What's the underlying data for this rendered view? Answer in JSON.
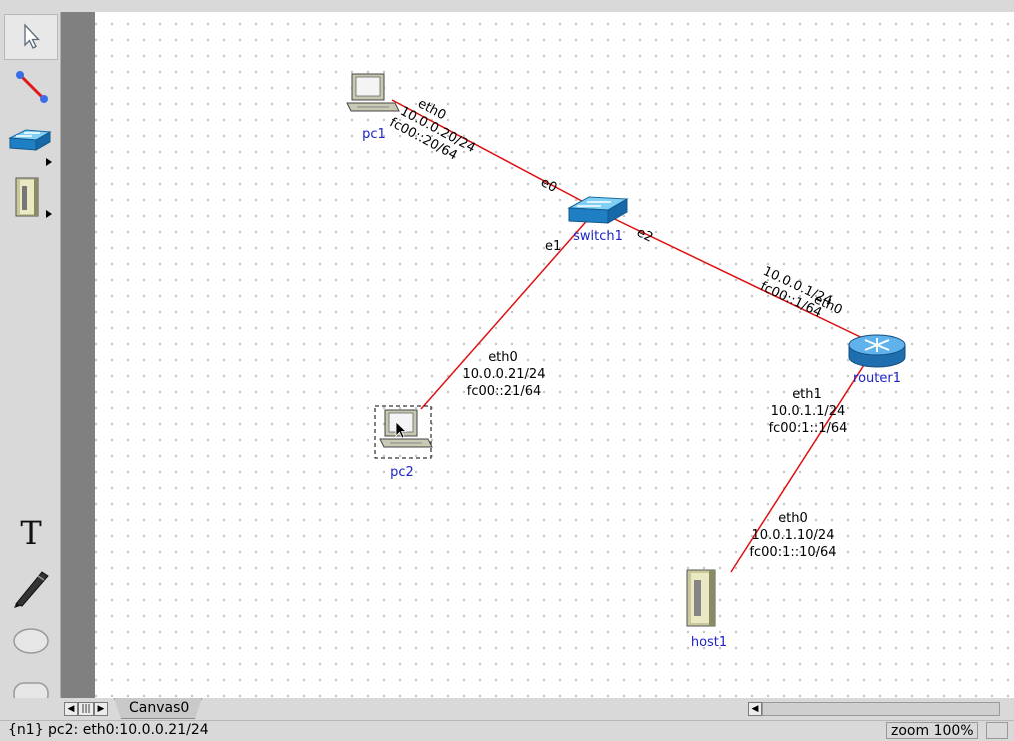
{
  "toolbar": {
    "tools": [
      {
        "name": "select-tool",
        "icon": "arrow-pointer-icon"
      },
      {
        "name": "link-tool",
        "icon": "link-line-icon"
      },
      {
        "name": "network-layer-tool",
        "icon": "switch-icon"
      },
      {
        "name": "link-layer-tool",
        "icon": "server-icon"
      },
      {
        "name": "text-tool",
        "icon": "text-T-icon"
      },
      {
        "name": "freehand-tool",
        "icon": "pen-icon"
      },
      {
        "name": "oval-tool",
        "icon": "oval-icon"
      },
      {
        "name": "rectangle-tool",
        "icon": "rounded-rect-icon"
      }
    ],
    "text_tool_glyph": "T"
  },
  "canvas": {
    "tab_label": "Canvas0",
    "nodes": {
      "pc1": {
        "label": "pc1"
      },
      "switch1": {
        "label": "switch1"
      },
      "router1": {
        "label": "router1"
      },
      "pc2": {
        "label": "pc2"
      },
      "host1": {
        "label": "host1"
      }
    },
    "interfaces": {
      "pc1_eth0": [
        "eth0",
        "10.0.0.20/24",
        "fc00::20/64"
      ],
      "switch1_e0": "e0",
      "switch1_e1": "e1",
      "switch1_e2": "e2",
      "router1_eth0": [
        "eth0",
        "10.0.0.1/24",
        "fc00::1/64"
      ],
      "pc2_eth0": [
        "eth0",
        "10.0.0.21/24",
        "fc00::21/64"
      ],
      "router1_eth1": [
        "eth1",
        "10.0.1.1/24",
        "fc00:1::1/64"
      ],
      "host1_eth0": [
        "eth0",
        "10.0.1.10/24",
        "fc00:1::10/64"
      ]
    },
    "link_color": "#e01010"
  },
  "status": {
    "text": "{n1} pc2: eth0:10.0.0.21/24",
    "zoom": "zoom 100%"
  }
}
